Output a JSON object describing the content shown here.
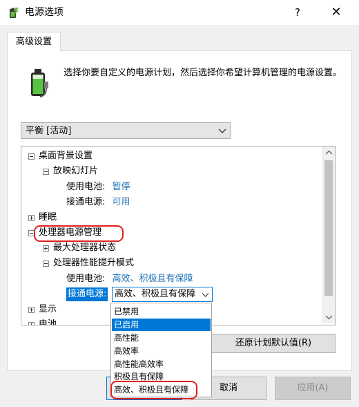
{
  "window": {
    "title": "电源选项",
    "help_glyph": "?",
    "close_glyph": "✕"
  },
  "tab": {
    "label": "高级设置"
  },
  "description": "选择你要自定义的电源计划，然后选择你希望计算机管理的电源设置。",
  "plan_select": {
    "value": "平衡 [活动]"
  },
  "tree": {
    "desktop_background": "桌面背景设置",
    "slideshow": "放映幻灯片",
    "on_battery_label": "使用电池:",
    "slideshow_battery_value": "暂停",
    "plugged_in_label": "接通电源:",
    "slideshow_ac_value": "可用",
    "sleep": "睡眠",
    "processor_power": "处理器电源管理",
    "max_processor_state": "最大处理器状态",
    "boost_mode": "处理器性能提升模式",
    "boost_battery_value": "高效、积极且有保障",
    "boost_ac_value": "高效、积极且有保障",
    "display": "显示",
    "battery": "电池"
  },
  "dropdown_options": [
    "已禁用",
    "已启用",
    "高性能",
    "高效率",
    "高性能高效率",
    "积极且有保障",
    "高效、积极且有保障"
  ],
  "selected_option": "已启用",
  "buttons": {
    "restore_defaults": "还原计划默认值(R)",
    "ok": "确定",
    "cancel": "取消",
    "apply": "应用(A)"
  },
  "colors": {
    "link": "#1a6fb5",
    "selection": "#0078d7",
    "annotation_red": "#e21f1f"
  }
}
